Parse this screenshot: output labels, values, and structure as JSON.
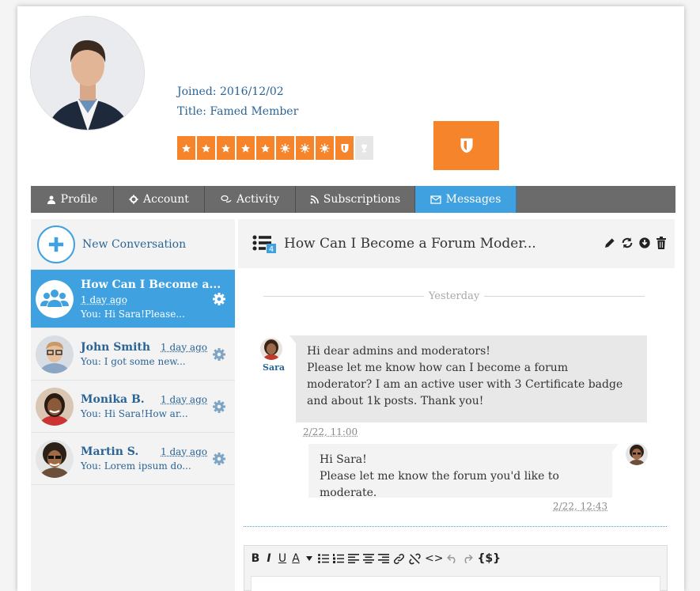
{
  "profile": {
    "joined": "Joined: 2016/12/02",
    "title": "Title: Famed Member"
  },
  "colors": {
    "accent": "#3fa1df",
    "badge": "#f5842b",
    "tabbar": "#6b6b6b"
  },
  "badges": {
    "small": [
      "star-icon",
      "star-icon",
      "star-icon",
      "star-icon",
      "star-icon",
      "sun-icon",
      "sun-icon",
      "sun-icon",
      "shield-icon",
      "trophy-icon"
    ],
    "large": "shield-icon"
  },
  "tabs": [
    {
      "label": "Profile",
      "icon": "user-icon"
    },
    {
      "label": "Account",
      "icon": "gear-icon"
    },
    {
      "label": "Activity",
      "icon": "chat-bubbles-icon"
    },
    {
      "label": "Subscriptions",
      "icon": "rss-icon"
    },
    {
      "label": "Messages",
      "icon": "envelope-icon",
      "active": true
    }
  ],
  "sidebar": {
    "new_conversation": "New Conversation",
    "conversations": [
      {
        "name": "How Can I Become a...",
        "time": "1 day ago",
        "preview": "You: Hi Sara!Please...",
        "active": true
      },
      {
        "name": "John Smith",
        "time": "1 day ago",
        "preview": "You: I got some new..."
      },
      {
        "name": "Monika B.",
        "time": "1 day ago",
        "preview": "You: Hi Sara!How ar..."
      },
      {
        "name": "Martin S.",
        "time": "1 day ago",
        "preview": "You: Lorem ipsum do..."
      }
    ]
  },
  "chat": {
    "participants_count": "4",
    "title": "How Can I Become a Forum Moder...",
    "day_separator": "Yesterday",
    "messages": [
      {
        "sender": "Sara",
        "line1": "Hi dear admins and moderators!",
        "line2": "Please let me know how can I become a forum moderator? I am an active user with 3 Certificate badge and about 1k posts. Thank you!",
        "time": "2/22, 11:00"
      },
      {
        "line1": "Hi Sara!",
        "line2": "Please let me know the forum you'd like to moderate.",
        "time": "2/22, 12:43"
      }
    ]
  },
  "editor": {
    "bold": "B",
    "italic": "I",
    "underline": "U",
    "font_color": "A",
    "code": "<>",
    "shortcode": "{$}"
  }
}
